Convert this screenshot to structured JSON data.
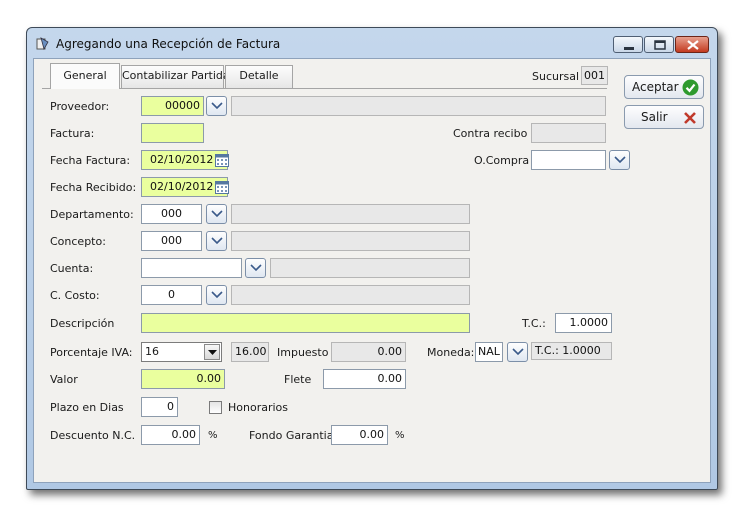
{
  "window": {
    "title": "Agregando una Recepción de Factura"
  },
  "tabs": [
    {
      "label": "General",
      "active": true
    },
    {
      "label": "Contabilizar Partidas",
      "active": false
    },
    {
      "label": "Detalle",
      "active": false
    }
  ],
  "sucursal": {
    "label": "Sucursal",
    "value": "001"
  },
  "buttons": {
    "accept": "Aceptar",
    "exit": "Salir"
  },
  "form": {
    "proveedor": {
      "label": "Proveedor:",
      "value": "00000",
      "name": ""
    },
    "factura": {
      "label": "Factura:",
      "value": ""
    },
    "contra_recibo": {
      "label": "Contra recibo",
      "value": ""
    },
    "fecha_factura": {
      "label": "Fecha Factura:",
      "value": "02/10/2012"
    },
    "ocompra": {
      "label": "O.Compra",
      "value": ""
    },
    "fecha_recibido": {
      "label": "Fecha Recibido:",
      "value": "02/10/2012"
    },
    "departamento": {
      "label": "Departamento:",
      "value": "000",
      "name": ""
    },
    "concepto": {
      "label": "Concepto:",
      "value": "000",
      "name": ""
    },
    "cuenta": {
      "label": "Cuenta:",
      "value": "",
      "name": ""
    },
    "c_costo": {
      "label": "C. Costo:",
      "value": "0",
      "name": ""
    },
    "descripcion": {
      "label": "Descripción",
      "value": ""
    },
    "tc": {
      "label": "T.C.:",
      "value": "1.0000"
    },
    "porcentaje_iva": {
      "label": "Porcentaje IVA:",
      "selected": "16",
      "rate": "16.00"
    },
    "impuesto": {
      "label": "Impuesto",
      "value": "0.00"
    },
    "moneda": {
      "label": "Moneda:",
      "value": "NAL",
      "tc_display": "T.C.: 1.0000"
    },
    "valor": {
      "label": "Valor",
      "value": "0.00"
    },
    "flete": {
      "label": "Flete",
      "value": "0.00"
    },
    "plazo_dias": {
      "label": "Plazo en Dias",
      "value": "0"
    },
    "honorarios": {
      "label": "Honorarios",
      "checked": false
    },
    "descuento_nc": {
      "label": "Descuento N.C.",
      "value": "0.00",
      "unit": "%"
    },
    "fondo_garantia": {
      "label": "Fondo Garantia",
      "value": "0.00",
      "unit": "%"
    }
  },
  "colors": {
    "required_field": "#eaff9e",
    "readonly_field": "#e8e8e8",
    "accept_icon": "#2e9a2e",
    "exit_icon": "#c0392b"
  }
}
